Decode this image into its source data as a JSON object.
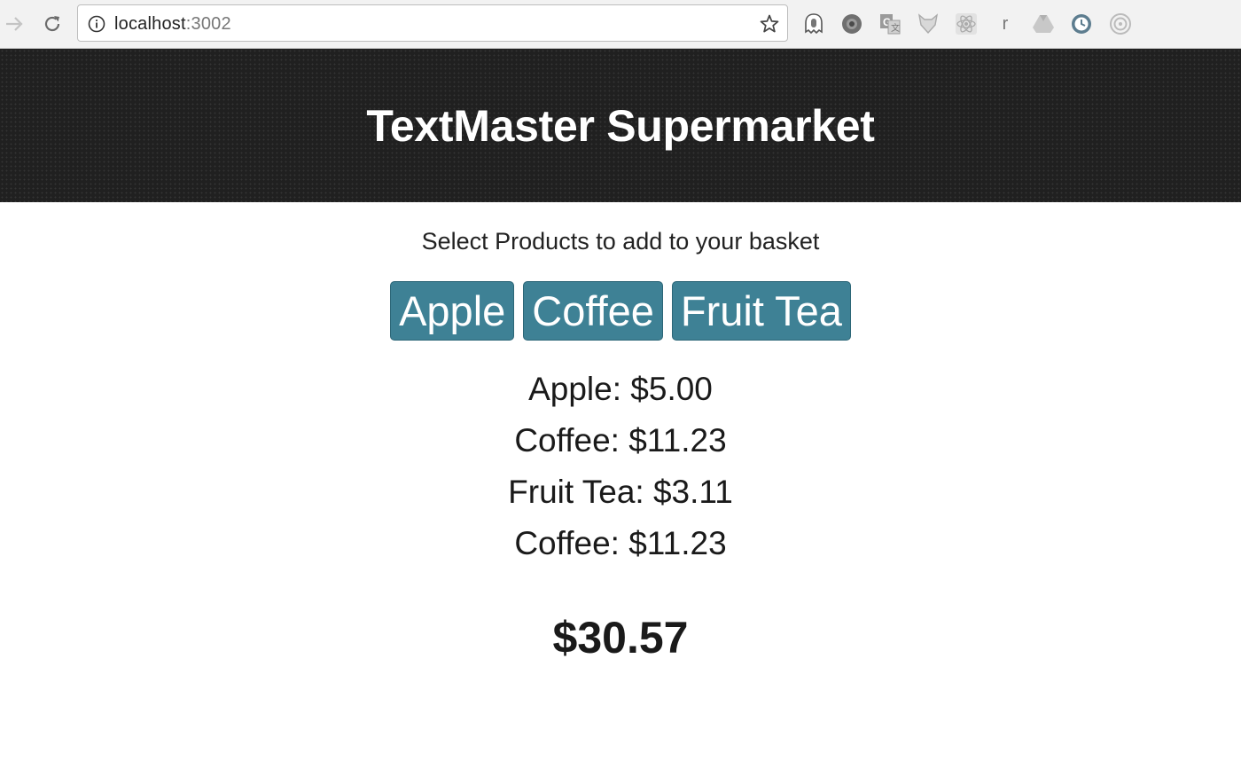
{
  "browser": {
    "url_host": "localhost",
    "url_port": ":3002",
    "extensions": [
      "ghostery-icon",
      "shield-circle-icon",
      "translate-icon",
      "fox-icon",
      "react-icon",
      "r-letter-icon",
      "drive-icon",
      "clock-sync-icon",
      "target-icon"
    ],
    "extension_r_letter": "r"
  },
  "header": {
    "title": "TextMaster Supermarket"
  },
  "main": {
    "instruction": "Select Products to add to your basket",
    "products": [
      {
        "label": "Apple"
      },
      {
        "label": "Coffee"
      },
      {
        "label": "Fruit Tea"
      }
    ],
    "basket": [
      {
        "text": "Apple: $5.00"
      },
      {
        "text": "Coffee: $11.23"
      },
      {
        "text": "Fruit Tea: $3.11"
      },
      {
        "text": "Coffee: $11.23"
      }
    ],
    "total": "$30.57"
  },
  "colors": {
    "header_bg": "#202020",
    "button_bg": "#3e8195",
    "text": "#1a1a1a"
  }
}
